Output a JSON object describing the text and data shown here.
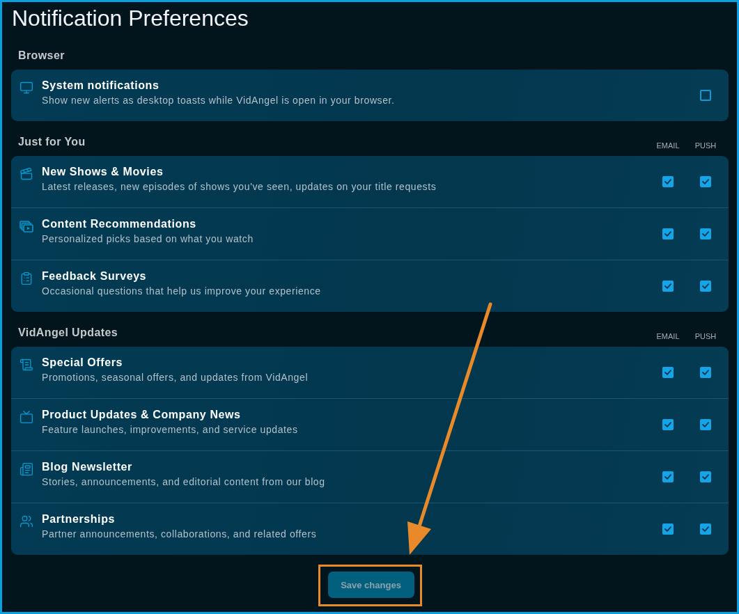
{
  "page": {
    "title": "Notification Preferences"
  },
  "sections": [
    {
      "title": "Browser",
      "rows": [
        {
          "title": "System notifications",
          "description": "Show new alerts as desktop toasts while VidAngel is open in your browser.",
          "checks": [
            {
              "checked": false
            }
          ]
        }
      ]
    },
    {
      "title": "Just for You",
      "columns": [
        "EMAIL",
        "PUSH"
      ],
      "rows": [
        {
          "title": "New Shows & Movies",
          "description": "Latest releases, new episodes of shows you've seen, updates on your title requests",
          "checks": [
            {
              "checked": true
            },
            {
              "checked": true
            }
          ]
        },
        {
          "title": "Content Recommendations",
          "description": "Personalized picks based on what you watch",
          "checks": [
            {
              "checked": true
            },
            {
              "checked": true
            }
          ]
        },
        {
          "title": "Feedback Surveys",
          "description": "Occasional questions that help us improve your experience",
          "checks": [
            {
              "checked": true
            },
            {
              "checked": true
            }
          ]
        }
      ]
    },
    {
      "title": "VidAngel Updates",
      "columns": [
        "EMAIL",
        "PUSH"
      ],
      "rows": [
        {
          "title": "Special Offers",
          "description": "Promotions, seasonal offers, and updates from VidAngel",
          "checks": [
            {
              "checked": true
            },
            {
              "checked": true
            }
          ]
        },
        {
          "title": "Product Updates & Company News",
          "description": "Feature launches, improvements, and service updates",
          "checks": [
            {
              "checked": true
            },
            {
              "checked": true
            }
          ]
        },
        {
          "title": "Blog Newsletter",
          "description": "Stories, announcements, and editorial content from our blog",
          "checks": [
            {
              "checked": true
            },
            {
              "checked": true
            }
          ]
        },
        {
          "title": "Partnerships",
          "description": "Partner announcements, collaborations, and related offers",
          "checks": [
            {
              "checked": true
            },
            {
              "checked": true
            }
          ]
        }
      ]
    }
  ],
  "save_button": {
    "label": "Save changes",
    "disabled": true,
    "highlighted": true
  },
  "annotations": [
    {
      "kind": "arrow"
    }
  ]
}
